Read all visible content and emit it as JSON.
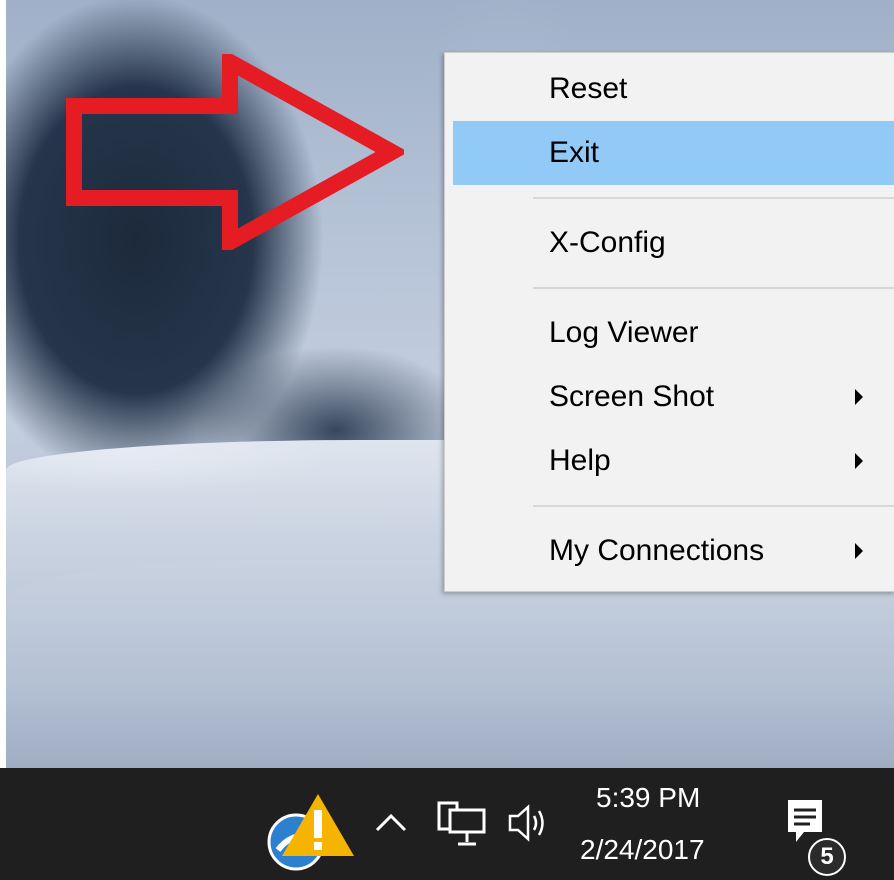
{
  "context_menu": {
    "items": [
      {
        "label": "Reset"
      },
      {
        "label": "Exit",
        "highlighted": true
      },
      {
        "label": "X-Config"
      },
      {
        "label": "Log Viewer"
      },
      {
        "label": "Screen Shot",
        "submenu": true
      },
      {
        "label": "Help",
        "submenu": true
      },
      {
        "label": "My Connections",
        "submenu": true
      }
    ],
    "highlight_color": "#91c9f7"
  },
  "annotation": {
    "icon": "red-arrow-icon",
    "color": "#e51c23"
  },
  "taskbar": {
    "time": "5:39 PM",
    "date": "2/24/2017",
    "notification_count": "5",
    "icons": [
      "x-server-warning-icon",
      "chevron-up-icon",
      "network-icon",
      "volume-icon",
      "action-center-icon"
    ]
  }
}
